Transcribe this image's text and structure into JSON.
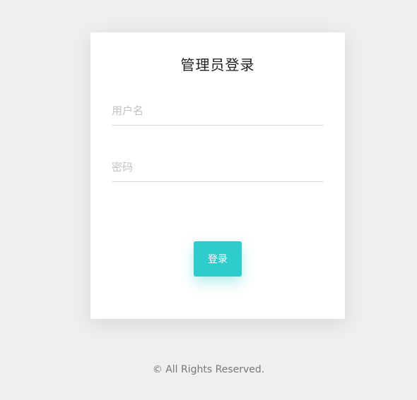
{
  "login": {
    "title": "管理员登录",
    "username_placeholder": "用户名",
    "username_value": "",
    "password_placeholder": "密码",
    "password_value": "",
    "submit_label": "登录"
  },
  "footer": {
    "text": "© All Rights Reserved."
  },
  "colors": {
    "background": "#efefef",
    "card": "#ffffff",
    "accent": "#2ecccc"
  }
}
